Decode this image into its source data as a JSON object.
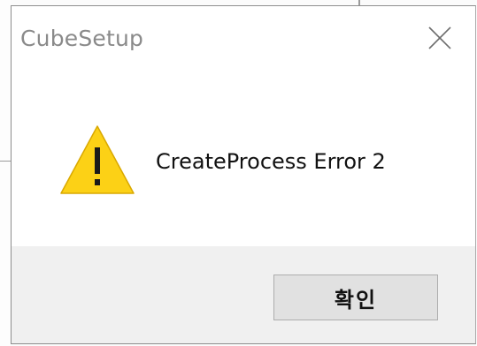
{
  "window": {
    "title": "CubeSetup",
    "close_icon": "close-icon"
  },
  "message": {
    "icon": "warning-icon",
    "text": "CreateProcess Error 2"
  },
  "buttons": {
    "ok_label": "확인"
  },
  "colors": {
    "warning_fill": "#fcd116",
    "title_text": "#8a8a8a",
    "footer_bg": "#f0f0f0",
    "button_bg": "#e1e1e1"
  }
}
